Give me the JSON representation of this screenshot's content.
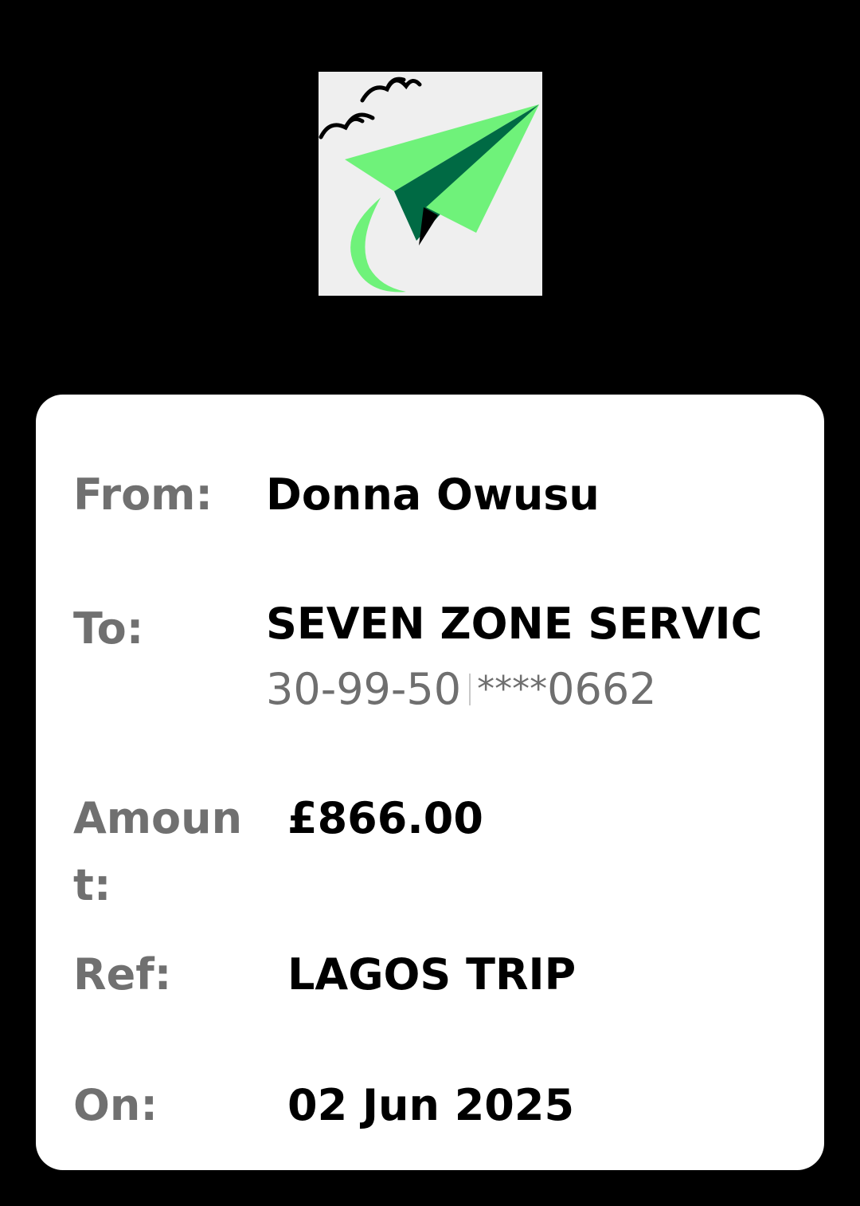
{
  "logo": {
    "icon": "paper-plane-logo-icon",
    "colors": {
      "background": "#efefef",
      "plane_light": "#6ff27a",
      "plane_dark": "#006a44",
      "birds": "#000000"
    }
  },
  "transfer": {
    "from_label": "From:",
    "from_value": "Donna Owusu",
    "to_label": "To:",
    "to_name": "SEVEN ZONE  SERVIC",
    "sort_code": "30-99-50",
    "account_mask": "****",
    "account_last4": "0662",
    "amount_label": "Amount:",
    "amount_value": "£866.00",
    "ref_label": "Ref:",
    "ref_value": "LAGOS TRIP",
    "on_label": "On:",
    "on_value": "02 Jun 2025"
  }
}
